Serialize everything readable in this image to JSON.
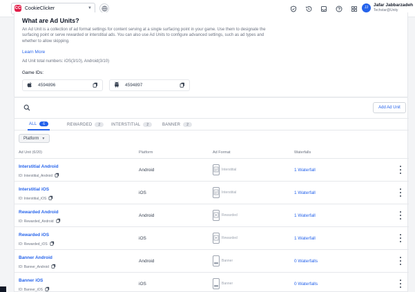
{
  "topbar": {
    "project_name": "CookieClicker",
    "project_logo": "CC",
    "icons": [
      "shield-icon",
      "history-icon",
      "inbox-icon",
      "help-icon",
      "apps-grid-icon"
    ],
    "user_name": "Jafar Jabbarzadeh",
    "user_org": "Techstar@Unity",
    "user_initials": "JJ"
  },
  "info": {
    "title": "What are Ad Units?",
    "description": "An Ad Unit is a collection of ad format settings for content serving at a single surfacing point in your game. Use them to designate the surfacing point or serve rewarded or interstitial ads. You can also use Ad Units to configure advanced settings, such as ad types and whether to allow skipping.",
    "learn_more": "Learn More",
    "total_numbers": "Ad Unit total numbers: iOS(3/10), Android(3/10)",
    "game_ids_label": "Game IDs:",
    "game_ids": [
      {
        "platform": "iOS",
        "icon": "apple-icon",
        "value": "4594896"
      },
      {
        "platform": "Android",
        "icon": "android-icon",
        "value": "4594897"
      }
    ]
  },
  "units": {
    "add_button": "Add Ad Unit",
    "tabs": [
      {
        "label": "ALL",
        "count": "6"
      },
      {
        "label": "REWARDED",
        "count": "2"
      },
      {
        "label": "INTERSTITIAL",
        "count": "2"
      },
      {
        "label": "BANNER",
        "count": "2"
      }
    ],
    "filter_label": "Platform",
    "columns": {
      "unit": "Ad Unit  (6/20)",
      "platform": "Platform",
      "format": "Ad Format",
      "waterfalls": "Waterfalls"
    },
    "rows": [
      {
        "name": "Interstitial Android",
        "id": "ID: Interstitial_Android",
        "platform": "Android",
        "format": "Interstitial",
        "format_icon": "phone-interstitial-icon",
        "waterfalls": "1 Waterfall"
      },
      {
        "name": "Interstitial iOS",
        "id": "ID: Interstitial_iOS",
        "platform": "iOS",
        "format": "Interstitial",
        "format_icon": "phone-interstitial-icon",
        "waterfalls": "1 Waterfall"
      },
      {
        "name": "Rewarded Android",
        "id": "ID: Rewarded_Android",
        "platform": "Android",
        "format": "Rewarded",
        "format_icon": "phone-rewarded-icon",
        "waterfalls": "1 Waterfall"
      },
      {
        "name": "Rewarded iOS",
        "id": "ID: Rewarded_iOS",
        "platform": "iOS",
        "format": "Rewarded",
        "format_icon": "phone-rewarded-icon",
        "waterfalls": "1 Waterfall"
      },
      {
        "name": "Banner Android",
        "id": "ID: Banner_Android",
        "platform": "Android",
        "format": "Banner",
        "format_icon": "phone-banner-icon",
        "waterfalls": "0 Waterfalls"
      },
      {
        "name": "Banner iOS",
        "id": "ID: Banner_iOS",
        "platform": "iOS",
        "format": "Banner",
        "format_icon": "phone-banner-icon",
        "waterfalls": "0 Waterfalls"
      }
    ]
  },
  "colors": {
    "accent": "#2563eb",
    "brand": "#e11d48"
  }
}
